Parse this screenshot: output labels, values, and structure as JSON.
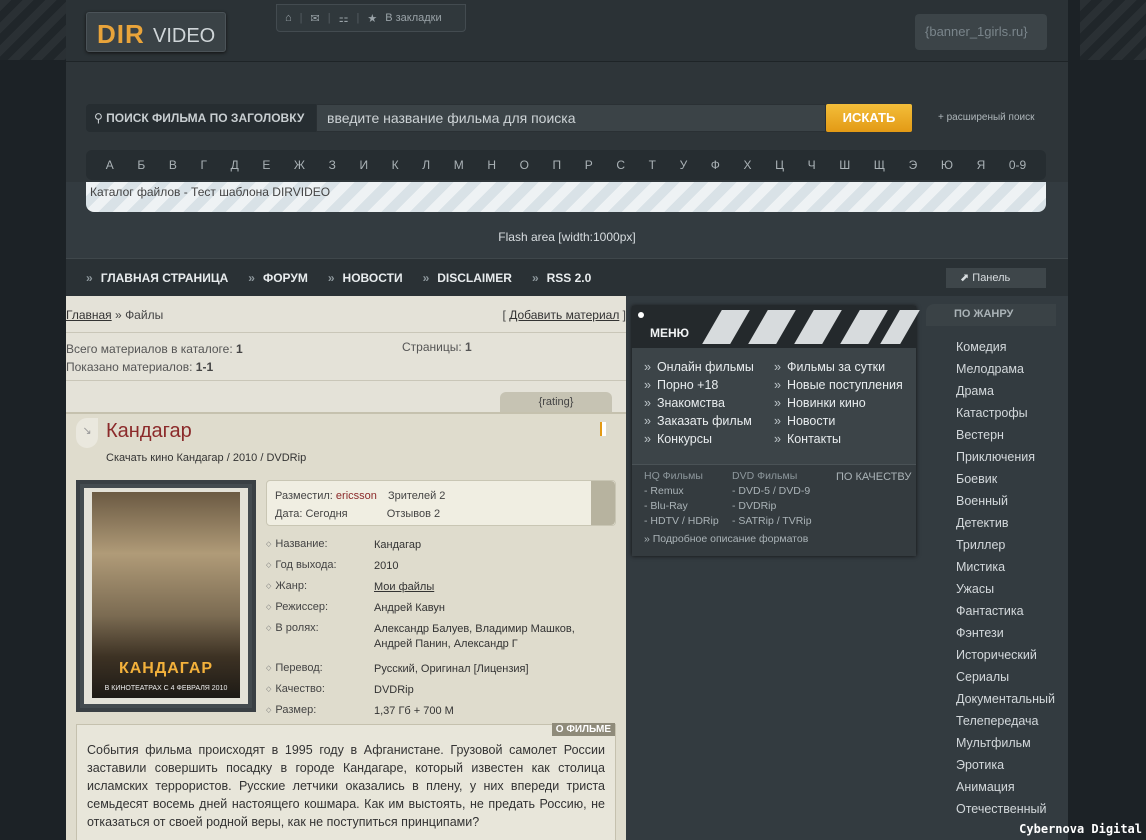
{
  "header": {
    "logo_dir": "DIR",
    "logo_video": "VIDEO",
    "bookmark_label": "В закладки",
    "banner_text": "{banner_1girls.ru}"
  },
  "search": {
    "label": "ПОИСК ФИЛЬМА ПО ЗАГОЛОВКУ",
    "placeholder": "введите название фильма для поиска",
    "button": "ИСКАТЬ",
    "advanced": "+ расширеный поиск"
  },
  "alphabet": [
    "А",
    "Б",
    "В",
    "Г",
    "Д",
    "Е",
    "Ж",
    "З",
    "И",
    "К",
    "Л",
    "М",
    "Н",
    "О",
    "П",
    "Р",
    "С",
    "Т",
    "У",
    "Ф",
    "Х",
    "Ц",
    "Ч",
    "Ш",
    "Щ",
    "Э",
    "Ю",
    "Я",
    "0-9"
  ],
  "catalog_caption": "Каталог файлов - Тест шаблона DIRVIDEO",
  "flash_area": "Flash area [width:1000px]",
  "nav": {
    "items": [
      "ГЛАВНАЯ СТРАНИЦА",
      "ФОРУМ",
      "НОВОСТИ",
      "DISCLAIMER",
      "RSS 2.0"
    ],
    "panel": "Панель"
  },
  "breadcrumb": {
    "home": "Главная",
    "sep": "»",
    "current": "Файлы"
  },
  "add_material": "Добавить материал",
  "stats": {
    "total_label": "Всего материалов в каталоге:",
    "total_value": "1",
    "shown_label": "Показано материалов:",
    "shown_value": "1-1",
    "pages_label": "Страницы:",
    "pages_value": "1"
  },
  "rating_tab": "{rating}",
  "entry": {
    "title": "Кандагар",
    "subtitle": "Скачать кино Кандагар / 2010 / DVDRip",
    "poster_title": "КАНДАГАР",
    "poster_date": "В КИНОТЕАТРАХ С 4 ФЕВРАЛЯ 2010",
    "posted_by_label": "Разместил:",
    "posted_by": "ericsson",
    "viewers": "Зрителей 2",
    "date_label": "Дата:",
    "date_value": "Сегодня",
    "reviews": "Отзывов 2",
    "details": [
      {
        "k": "Название:",
        "v": "Кандагар"
      },
      {
        "k": "Год выхода:",
        "v": "2010"
      },
      {
        "k": "Жанр:",
        "v": "Мои файлы"
      },
      {
        "k": "Режиссер:",
        "v": "Андрей Кавун"
      },
      {
        "k": "В ролях:",
        "v": "Александр Балуев, Владимир Машков, Андрей Панин, Александр Г"
      },
      {
        "k": "Перевод:",
        "v": "Русский, Оригинал [Лицензия]"
      },
      {
        "k": "Качество:",
        "v": "DVDRip"
      },
      {
        "k": "Размер:",
        "v": "1,37 Гб + 700 M"
      }
    ],
    "about_tag": "О ФИЛЬМЕ",
    "about_text": "События фильма происходят в 1995 году в Афганистане. Грузовой самолет России заставили совершить посадку в городе Кандагаре, который известен как столица исламских террористов. Русские летчики оказались в плену, у них впереди триста семьдесят восемь дней настоящего кошмара. Как им выстоять, не предать Россию, не отказаться от своей родной веры, как не поступиться принципами?"
  },
  "menu": {
    "title": "МЕНЮ",
    "col1": [
      "Онлайн фильмы",
      "Порно +18",
      "Знакомства",
      "Заказать фильм",
      "Конкурсы"
    ],
    "col2": [
      "Фильмы за сутки",
      "Новые поступления",
      "Новинки кино",
      "Новости",
      "Контакты"
    ],
    "quality_title": "ПО КАЧЕСТВУ",
    "hq_title": "HQ Фильмы",
    "hq_items": [
      "- Remux",
      "- Blu-Ray",
      "- HDTV / HDRip"
    ],
    "dvd_title": "DVD Фильмы",
    "dvd_items": [
      "- DVD-5 / DVD-9",
      "- DVDRip",
      "- SATRip / TVRip"
    ],
    "formats_link": "» Подробное описание форматов"
  },
  "genres": {
    "title": "ПО ЖАНРУ",
    "items": [
      "Комедия",
      "Мелодрама",
      "Драма",
      "Катастрофы",
      "Вестерн",
      "Приключения",
      "Боевик",
      "Военный",
      "Детектив",
      "Триллер",
      "Мистика",
      "Ужасы",
      "Фантастика",
      "Фэнтези",
      "Исторический",
      "Сериалы",
      "Документальный",
      "Телепередача",
      "Мультфильм",
      "Эротика",
      "Анимация",
      "Отечественный"
    ]
  },
  "watermark": "Cybernova Digital",
  "colors": {
    "accent": "#e9a43a",
    "title_red": "#8b2a2a",
    "search_button": "#f3be3a"
  }
}
